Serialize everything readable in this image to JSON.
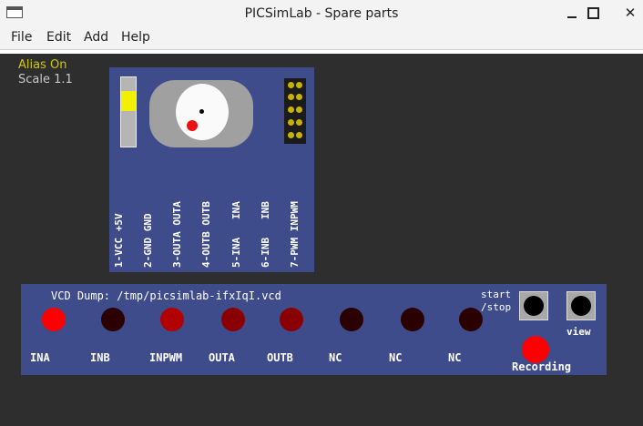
{
  "window": {
    "title": "PICSimLab - Spare parts"
  },
  "menu": [
    "File",
    "Edit",
    "Add",
    "Help"
  ],
  "canvas": {
    "alias": "Alias On",
    "scale": "Scale 1.1"
  },
  "encoder_board": {
    "pins": [
      "1-VCC +5V",
      "2-GND GND",
      "3-OUTA OUTA",
      "4-OUTB OUTB",
      "5-INA   INA",
      "6-INB   INB",
      "7-PWM INPWM"
    ]
  },
  "vcd_board": {
    "title": "VCD Dump: /tmp/picsimlab-ifxIqI.vcd",
    "channels": [
      {
        "label": "INA",
        "color": "#ff0000"
      },
      {
        "label": "INB",
        "color": "#2a0000"
      },
      {
        "label": "INPWM",
        "color": "#b00000"
      },
      {
        "label": "OUTA",
        "color": "#8a0000"
      },
      {
        "label": "OUTB",
        "color": "#8a0000"
      },
      {
        "label": "NC",
        "color": "#2a0000"
      },
      {
        "label": "NC",
        "color": "#2a0000"
      },
      {
        "label": "NC",
        "color": "#2a0000"
      }
    ],
    "start_label_1": "start",
    "start_label_2": "/stop",
    "view_label": "view",
    "recording_label": "Recording"
  }
}
